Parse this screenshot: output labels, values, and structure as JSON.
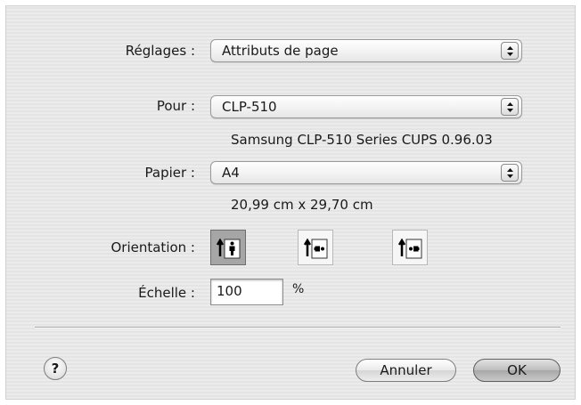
{
  "settings": {
    "label": "Réglages :",
    "value": "Attributs de page"
  },
  "format_for": {
    "label": "Pour :",
    "value": "CLP-510",
    "description": "Samsung CLP-510 Series CUPS 0.96.03"
  },
  "paper": {
    "label": "Papier :",
    "value": "A4",
    "dimensions": "20,99 cm x 29,70 cm"
  },
  "orientation": {
    "label": "Orientation :",
    "options": [
      {
        "icon": "portrait-orientation-icon",
        "selected": true
      },
      {
        "icon": "landscape-left-orientation-icon",
        "selected": false
      },
      {
        "icon": "landscape-right-orientation-icon",
        "selected": false
      }
    ]
  },
  "scale": {
    "label": "Échelle :",
    "value": "100",
    "unit": "%"
  },
  "help": {
    "glyph": "?"
  },
  "buttons": {
    "cancel": "Annuler",
    "ok": "OK"
  },
  "colors": {
    "selected_orientation": "#a6a6a6",
    "dialog_bg": "#ececec"
  }
}
